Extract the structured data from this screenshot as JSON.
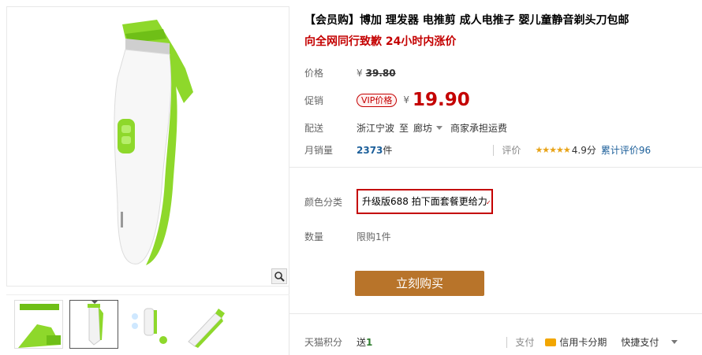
{
  "product": {
    "title": "【会员购】博加 理发器 电推剪 成人电推子 婴儿童静音剃头刀包邮",
    "subtitle": "向全网同行致歉 24小时内涨价"
  },
  "price": {
    "label": "价格",
    "currency": "¥",
    "original": "39.80"
  },
  "promo": {
    "label": "促销",
    "badge": "VIP价格",
    "currency": "¥",
    "value": "19.90"
  },
  "shipping": {
    "label": "配送",
    "origin": "浙江宁波",
    "to": "至",
    "destination": "廊坊",
    "fee": "商家承担运费"
  },
  "sales": {
    "label": "月销量",
    "count": "2373",
    "unit": "件",
    "rating_label": "评价",
    "stars": "★★★★★",
    "score": "4.9分",
    "total_reviews": "累计评价96"
  },
  "sku": {
    "label": "颜色分类",
    "selected": "升级版688 拍下面套餐更给力"
  },
  "quantity": {
    "label": "数量",
    "limit": "限购1件"
  },
  "buy_button": "立刻购买",
  "footer": {
    "points_label": "天猫积分",
    "points_prefix": "送",
    "points_value": "1",
    "pay_label": "支付",
    "credit": "信用卡分期",
    "quick_pay": "快捷支付"
  },
  "colors": {
    "accent": "#c40000",
    "buy_button": "#b8742a",
    "product_green": "#8ed82b"
  }
}
